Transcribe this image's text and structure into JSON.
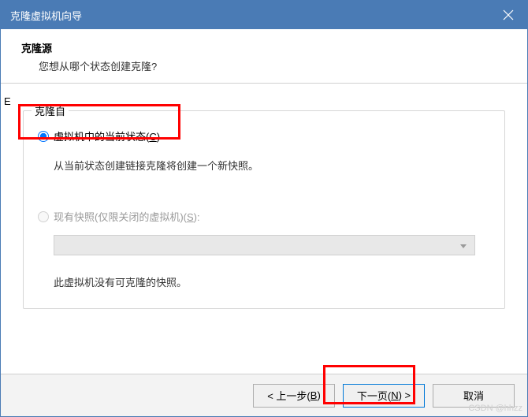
{
  "titlebar": {
    "title": "克隆虚拟机向导"
  },
  "header": {
    "heading": "克隆源",
    "sub": "您想从哪个状态创建克隆?"
  },
  "group": {
    "legend": "克隆自",
    "option1": {
      "label_a": "虚拟机中的当前状态(",
      "label_k": "C",
      "label_b": ")",
      "note": "从当前状态创建链接克隆将创建一个新快照。"
    },
    "option2": {
      "label_a": "现有快照(仅限关闭的虚拟机)(",
      "label_k": "S",
      "label_b": "):",
      "no_snap": "此虚拟机没有可克隆的快照。"
    }
  },
  "buttons": {
    "back_a": "< 上一步(",
    "back_k": "B",
    "back_b": ")",
    "next_a": "下一页(",
    "next_k": "N",
    "next_b": ") >",
    "cancel": "取消"
  },
  "watermark": "CSDN @hhzz",
  "stray": "E"
}
